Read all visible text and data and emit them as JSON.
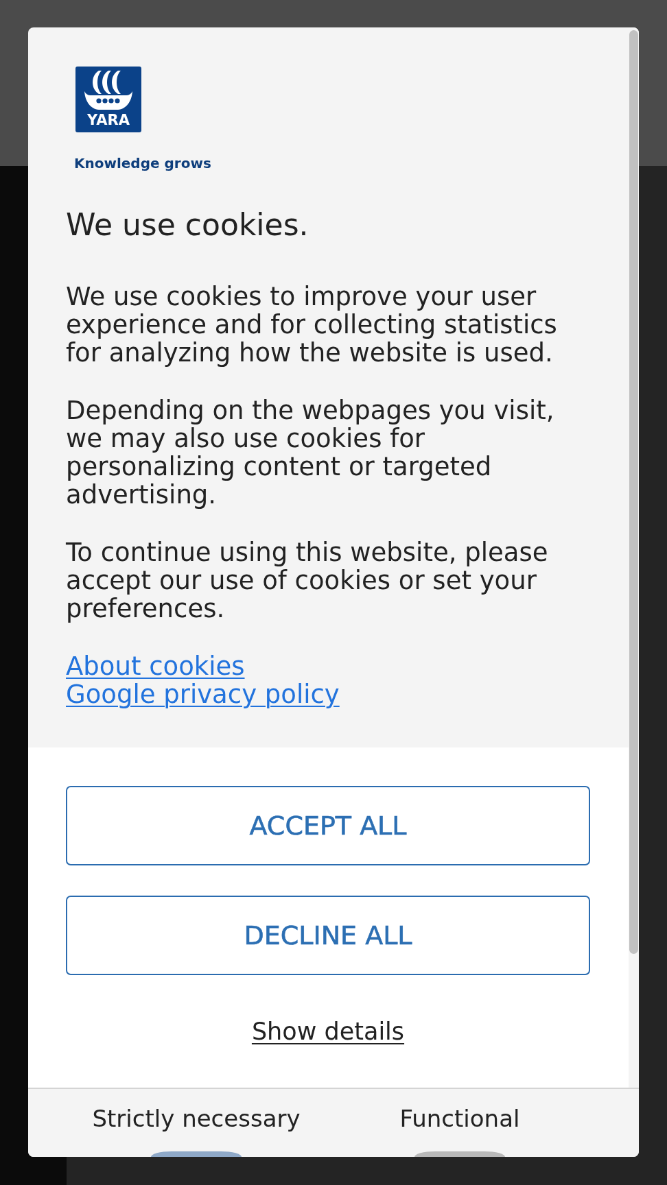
{
  "logo": {
    "wordmark": "YARA",
    "tagline": "Knowledge grows"
  },
  "dialog": {
    "title": "We use cookies.",
    "paragraphs": [
      "We use cookies to improve your user experience and for collecting statistics for analyzing how the website is used.",
      "Depending on the webpages you visit, we may also use cookies for personalizing content or targeted advertising.",
      "To continue using this website, please accept our use of cookies or set your preferences."
    ],
    "links": [
      "About cookies",
      "Google privacy policy"
    ],
    "buttons": [
      "ACCEPT ALL",
      "DECLINE ALL"
    ],
    "details_link": "Show details",
    "categories": [
      {
        "label": "Strictly necessary",
        "on": true
      },
      {
        "label": "Functional",
        "on": false
      }
    ]
  }
}
